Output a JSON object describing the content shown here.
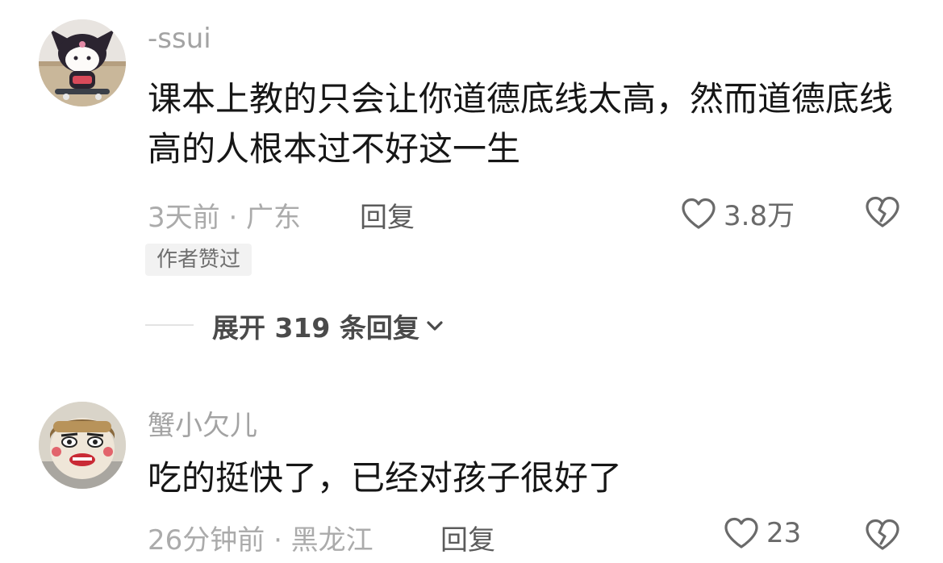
{
  "comments": [
    {
      "username": "-ssui",
      "text": "课本上教的只会让你道德底线太高，然而道德底线高的人根本过不好这一生",
      "meta": "3天前 · 广东",
      "reply_label": "回复",
      "likes": "3.8万",
      "badge": "作者赞过",
      "expand_label": "展开 319 条回复"
    },
    {
      "username": "蟹小欠儿",
      "text": "吃的挺快了，已经对孩子很好了",
      "meta": "26分钟前 · 黑龙江",
      "reply_label": "回复",
      "likes": "23"
    }
  ],
  "icons": {
    "like": "heart-outline-icon",
    "dislike": "broken-heart-icon",
    "expand": "chevron-down-icon"
  },
  "colors": {
    "username": "#a3a3a3",
    "text": "#161616",
    "meta": "#ababab",
    "icon": "#6a6a6a"
  }
}
